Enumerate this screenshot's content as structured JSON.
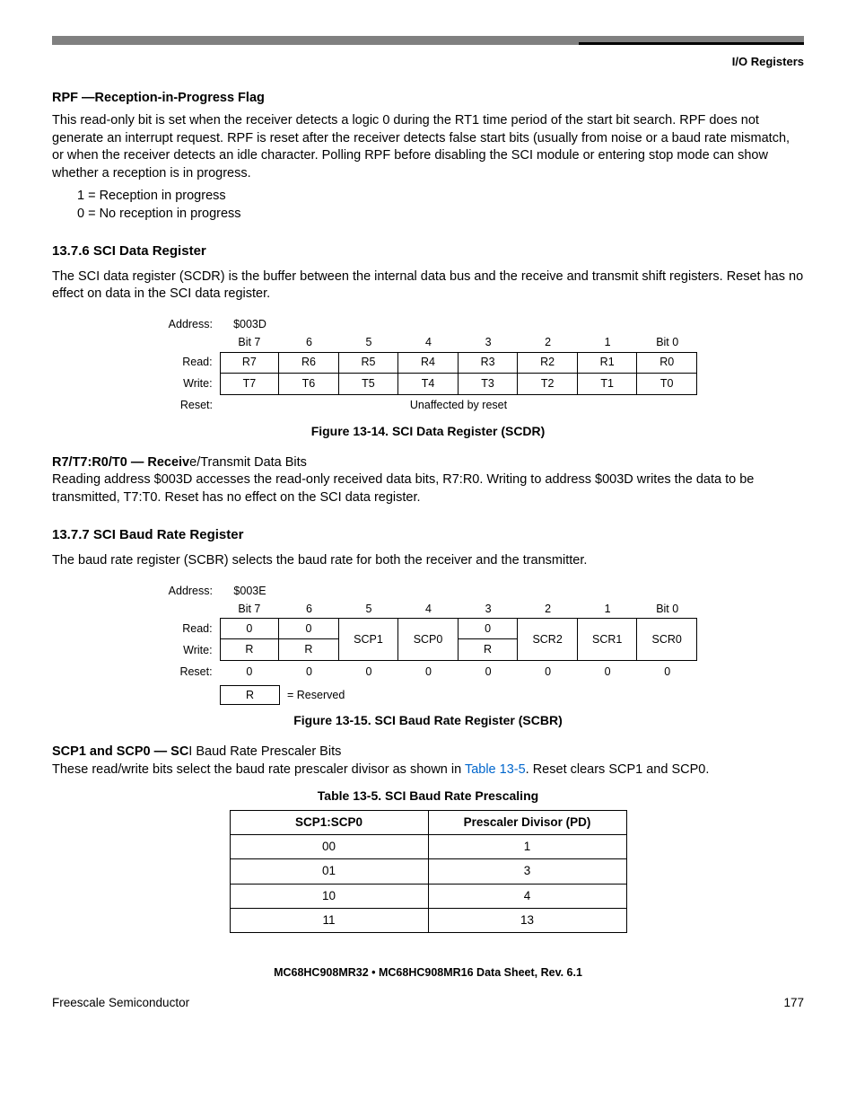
{
  "header": {
    "section": "I/O Registers"
  },
  "rpf": {
    "title": "RPF —Reception-in-Progress Flag",
    "body": "This read-only bit is set when the receiver detects a logic 0 during the RT1 time period of the start bit search. RPF does not generate an interrupt request. RPF is reset after the receiver detects false start bits (usually from noise or a baud rate mismatch, or when the receiver detects an idle character. Polling RPF before disabling the SCI module or entering stop mode can show whether a reception is in progress.",
    "v1": "1 = Reception in progress",
    "v0": "0 = No reception in progress"
  },
  "s1376": {
    "heading": "13.7.6  SCI Data Register",
    "body": "The SCI data register (SCDR) is the buffer between the internal data bus and the receive and transmit shift registers. Reset has no effect on data in the SCI data register.",
    "address_label": "Address:",
    "address_val": "$003D",
    "bit_headers": [
      "Bit 7",
      "6",
      "5",
      "4",
      "3",
      "2",
      "1",
      "Bit 0"
    ],
    "read_label": "Read:",
    "write_label": "Write:",
    "reset_label": "Reset:",
    "reset_text": "Unaffected by reset",
    "read_row": [
      "R7",
      "R6",
      "R5",
      "R4",
      "R3",
      "R2",
      "R1",
      "R0"
    ],
    "write_row": [
      "T7",
      "T6",
      "T5",
      "T4",
      "T3",
      "T2",
      "T1",
      "T0"
    ],
    "caption": "Figure 13-14. SCI Data Register (SCDR)",
    "bits_title_bold": "R7/T7:R0/T0 — Receiv",
    "bits_title_rest": "e/Transmit Data Bits",
    "bits_body": "Reading address $003D accesses the read-only received data bits, R7:R0. Writing to address $003D writes the data to be transmitted, T7:T0. Reset has no effect on the SCI data register."
  },
  "s1377": {
    "heading": "13.7.7  SCI Baud Rate Register",
    "body": "The baud rate register (SCBR) selects the baud rate for both the receiver and the transmitter.",
    "address_label": "Address:",
    "address_val": "$003E",
    "bit_headers": [
      "Bit 7",
      "6",
      "5",
      "4",
      "3",
      "2",
      "1",
      "Bit 0"
    ],
    "read_label": "Read:",
    "write_label": "Write:",
    "reset_label": "Reset:",
    "read_row": [
      "0",
      "0",
      "",
      "",
      "0",
      "",
      "",
      ""
    ],
    "write_row": [
      "R",
      "R",
      "",
      "",
      "R",
      "",
      "",
      ""
    ],
    "merged": {
      "c5": "SCP1",
      "c4": "SCP0",
      "c2": "SCR2",
      "c1": "SCR1",
      "c0": "SCR0"
    },
    "reset_row": [
      "0",
      "0",
      "0",
      "0",
      "0",
      "0",
      "0",
      "0"
    ],
    "reserved_sym": "R",
    "reserved_label": "= Reserved",
    "caption": "Figure 13-15. SCI Baud Rate Register (SCBR)",
    "scp_title_bold": "SCP1 and SCP0 — SC",
    "scp_title_rest": "I Baud Rate Prescaler Bits",
    "scp_body_a": "These read/write bits select the baud rate prescaler divisor as shown in ",
    "scp_link": "Table 13-5",
    "scp_body_b": ". Reset clears SCP1 and SCP0."
  },
  "table135": {
    "caption": "Table 13-5. SCI Baud Rate Prescaling",
    "h1": "SCP1:SCP0",
    "h2": "Prescaler Divisor (PD)",
    "rows": [
      {
        "a": "00",
        "b": "1"
      },
      {
        "a": "01",
        "b": "3"
      },
      {
        "a": "10",
        "b": "4"
      },
      {
        "a": "11",
        "b": "13"
      }
    ]
  },
  "footer": {
    "center": "MC68HC908MR32 • MC68HC908MR16 Data Sheet, Rev. 6.1",
    "left": "Freescale Semiconductor",
    "right": "177"
  }
}
